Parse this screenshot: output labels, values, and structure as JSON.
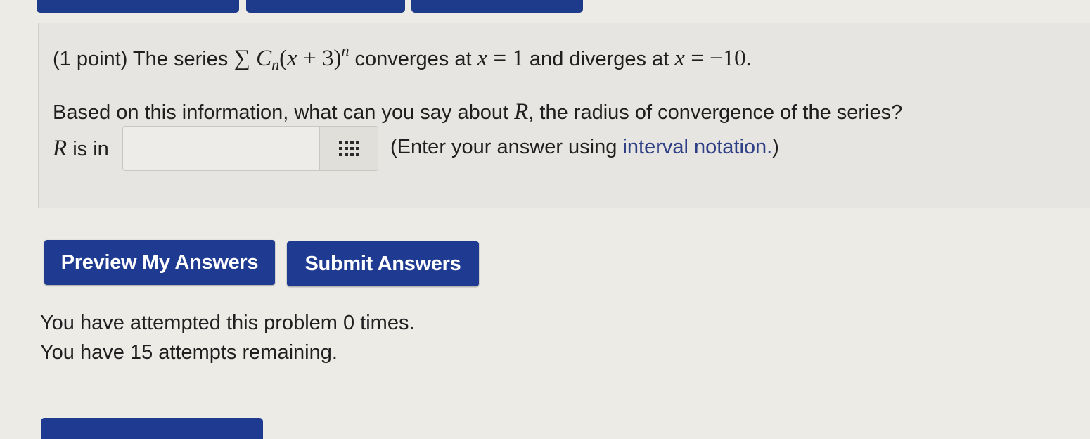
{
  "problem": {
    "prefix": "(1 point) The series ",
    "sigma": "∑",
    "coef_var": "C",
    "coef_sub": "n",
    "inner_open": "(",
    "inner_var": "x",
    "inner_rest": " + 3)",
    "exponent": "n",
    "mid_text": " converges at ",
    "x1_var": "x",
    "x1_rest": " = 1",
    "and_text": " and diverges at ",
    "x2_var": "x",
    "x2_rest": " = −10."
  },
  "question": {
    "prefix": "Based on this information, what can you say about ",
    "R": "R",
    "suffix": ", the radius of convergence of the series?"
  },
  "answer_row": {
    "R": "R",
    "label": " is in",
    "input_value": "",
    "palette_icon": "grid-palette-icon",
    "hint_prefix": "(Enter your answer using ",
    "hint_link": "interval notation.",
    "hint_suffix": ")"
  },
  "buttons": {
    "preview": "Preview My Answers",
    "submit": "Submit Answers"
  },
  "status": {
    "attempted": "You have attempted this problem 0 times.",
    "remaining": "You have 15 attempts remaining."
  },
  "colors": {
    "button_bg": "#1e3b91",
    "link": "#2e3f86",
    "page_bg": "#ecebe6",
    "panel_bg": "#e6e5e1"
  }
}
